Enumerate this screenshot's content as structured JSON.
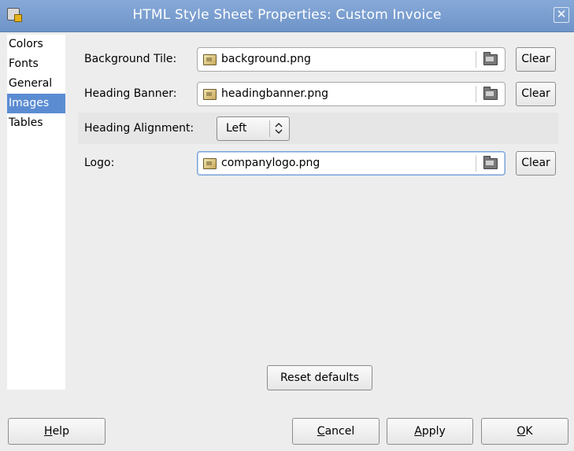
{
  "window": {
    "title": "HTML Style Sheet Properties: Custom Invoice",
    "close_glyph": "✕"
  },
  "sidebar": {
    "items": [
      {
        "label": "Colors",
        "selected": false
      },
      {
        "label": "Fonts",
        "selected": false
      },
      {
        "label": "General",
        "selected": false
      },
      {
        "label": "Images",
        "selected": true
      },
      {
        "label": "Tables",
        "selected": false
      }
    ]
  },
  "images_panel": {
    "background_tile": {
      "label": "Background Tile:",
      "value": "background.png",
      "clear_label": "Clear"
    },
    "heading_banner": {
      "label": "Heading Banner:",
      "value": "headingbanner.png",
      "clear_label": "Clear"
    },
    "heading_alignment": {
      "label": "Heading Alignment:",
      "value": "Left",
      "arrow": "⇕"
    },
    "logo": {
      "label": "Logo:",
      "value": "companylogo.png",
      "clear_label": "Clear"
    }
  },
  "buttons": {
    "reset_defaults": "Reset defaults",
    "help_mnemonic": "H",
    "help_rest": "elp",
    "cancel_mnemonic": "C",
    "cancel_rest": "ancel",
    "apply_mnemonic": "A",
    "apply_rest": "pply",
    "ok_mnemonic": "O",
    "ok_rest": "K"
  },
  "colors": {
    "titlebar": "#7b9ed0",
    "selection": "#5b8cd2",
    "dialog_bg": "#ededed"
  },
  "icons": {
    "app": "app-icon",
    "close": "close-icon",
    "file": "image-file-icon",
    "browse": "folder-icon",
    "select_arrow": "up-down-arrow-icon"
  }
}
